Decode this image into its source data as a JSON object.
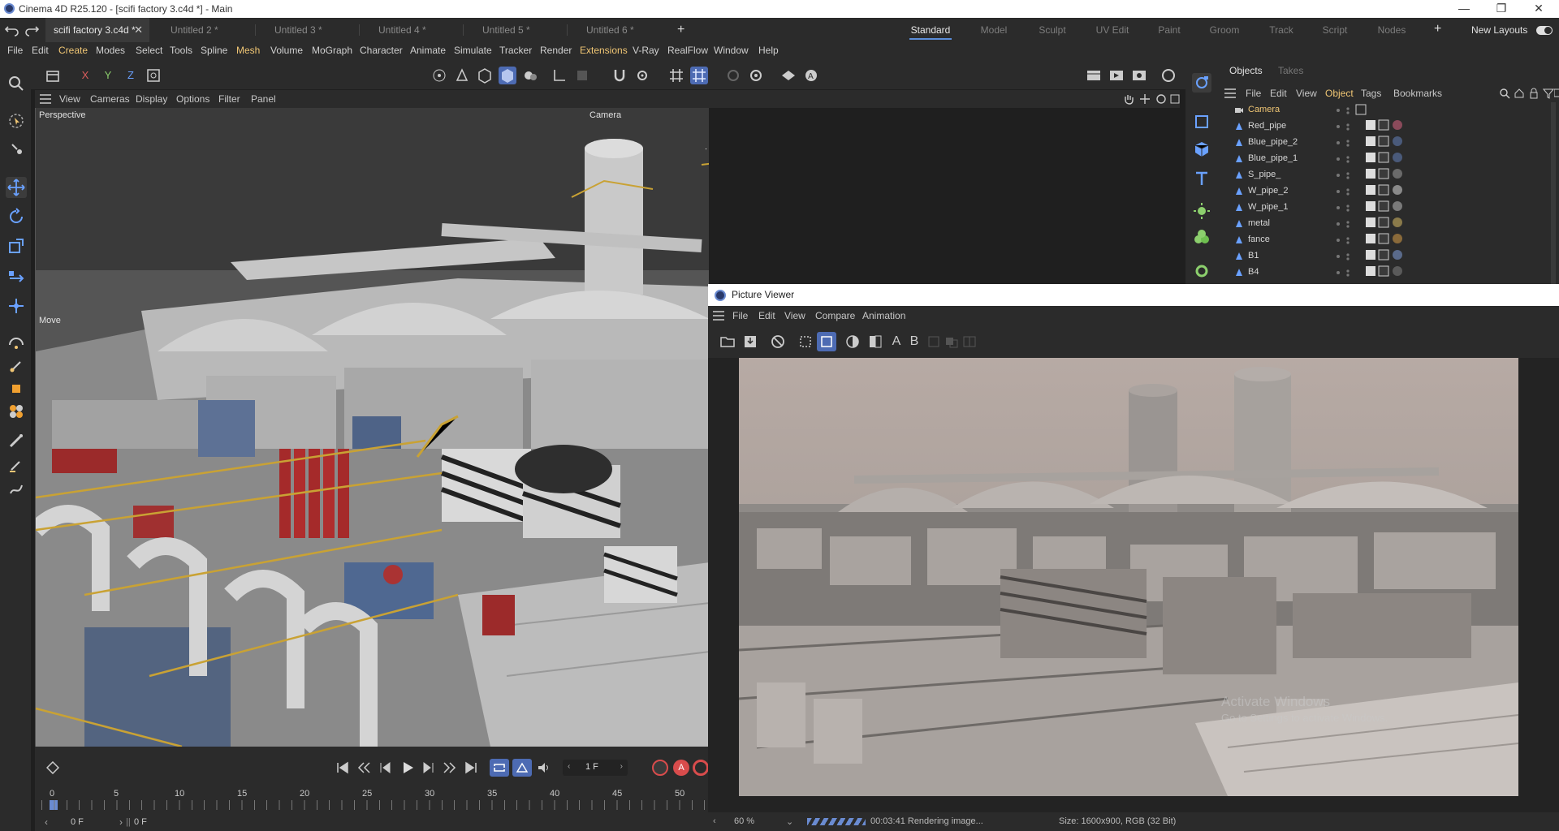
{
  "window": {
    "title": "Cinema 4D R25.120 - [scifi factory 3.c4d *] - Main",
    "controls": [
      "minimize-icon",
      "restore-icon",
      "close-icon"
    ]
  },
  "tabs": [
    {
      "label": "scifi factory 3.c4d *",
      "active": true
    },
    {
      "label": "Untitled 2 *"
    },
    {
      "label": "Untitled 3 *"
    },
    {
      "label": "Untitled 4 *"
    },
    {
      "label": "Untitled 5 *"
    },
    {
      "label": "Untitled 6 *"
    }
  ],
  "layouts": [
    "Standard",
    "Model",
    "Sculpt",
    "UV Edit",
    "Paint",
    "Groom",
    "Track",
    "Script",
    "Nodes"
  ],
  "new_layouts_label": "New Layouts",
  "menu": [
    "File",
    "Edit",
    "Create",
    "Modes",
    "Select",
    "Tools",
    "Spline",
    "Mesh",
    "Volume",
    "MoGraph",
    "Character",
    "Animate",
    "Simulate",
    "Tracker",
    "Render",
    "Extensions",
    "V-Ray",
    "RealFlow",
    "Window",
    "Help"
  ],
  "axis_buttons": [
    "X",
    "Y",
    "Z"
  ],
  "viewport": {
    "menu": [
      "View",
      "Cameras",
      "Display",
      "Options",
      "Filter",
      "Panel"
    ],
    "name": "Perspective",
    "camera_label": "Camera",
    "move_label": "Move"
  },
  "objects_panel": {
    "tabs": [
      "Objects",
      "Takes"
    ],
    "menu": [
      "File",
      "Edit",
      "View",
      "Object",
      "Tags",
      "Bookmarks"
    ],
    "items": [
      {
        "name": "Camera",
        "type": "camera"
      },
      {
        "name": "Red_pipe"
      },
      {
        "name": "Blue_pipe_2"
      },
      {
        "name": "Blue_pipe_1"
      },
      {
        "name": "S_pipe_"
      },
      {
        "name": "W_pipe_2"
      },
      {
        "name": "W_pipe_1"
      },
      {
        "name": "metal"
      },
      {
        "name": "fance"
      },
      {
        "name": "B1"
      },
      {
        "name": "B4"
      }
    ]
  },
  "timeline": {
    "ticks": [
      "0",
      "5",
      "10",
      "15",
      "20",
      "25",
      "30",
      "35",
      "40",
      "45",
      "50"
    ],
    "current_frame": "1 F",
    "start_frame": "0 F",
    "end_frame": "0 F"
  },
  "picture_viewer": {
    "title": "Picture Viewer",
    "menu": [
      "File",
      "Edit",
      "View",
      "Compare",
      "Animation"
    ],
    "zoom": "60 %",
    "progress_text": "00:03:41 Rendering image...",
    "size_text": "Size: 1600x900, RGB (32 Bit)",
    "watermark_title": "Activate Windows",
    "watermark_sub": "Go to Settings to activate Windows."
  },
  "colors": {
    "accent": "#4d6bb3",
    "highlight": "#f0c674"
  }
}
